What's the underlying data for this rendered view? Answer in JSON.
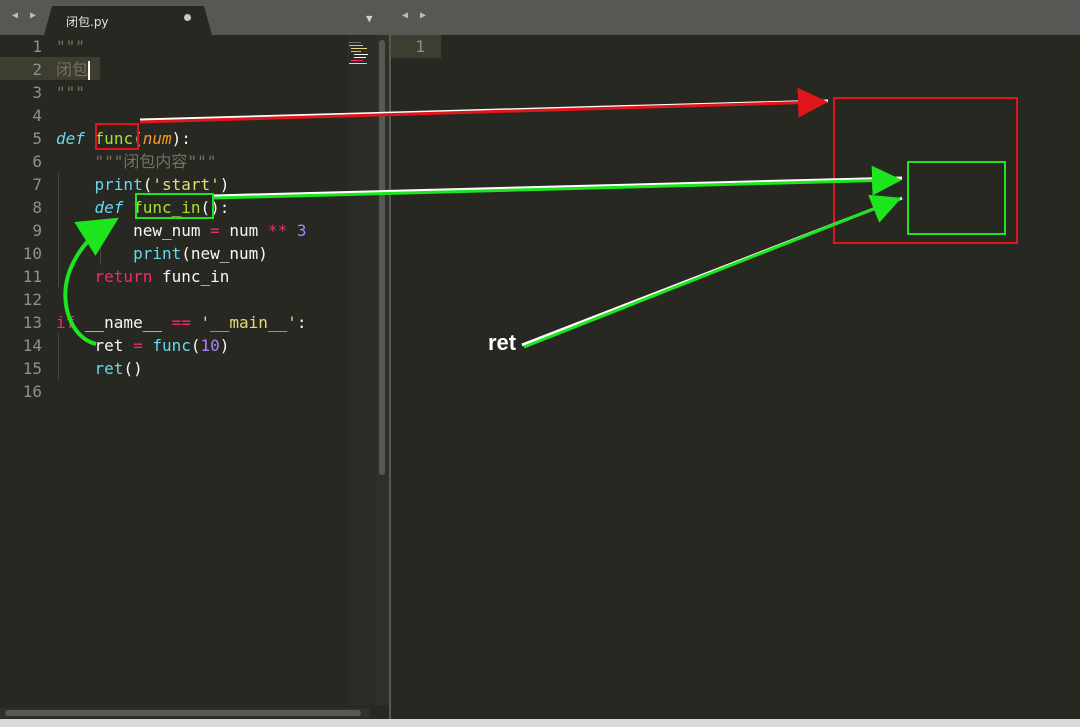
{
  "tab": {
    "title": "闭包.py"
  },
  "colors": {
    "red_annotation": "#e0161b",
    "green_annotation": "#1ee61e"
  },
  "icons": [
    "nav-arrows-icon",
    "unsaved-dot-icon",
    "dropdown-icon"
  ],
  "editor": {
    "line_numbers": [
      "1",
      "2",
      "3",
      "4",
      "5",
      "6",
      "7",
      "8",
      "9",
      "10",
      "11",
      "12",
      "13",
      "14",
      "15",
      "16"
    ],
    "lines": [
      {
        "segments": [
          {
            "t": "\"\"\"",
            "c": "cmt"
          }
        ]
      },
      {
        "segments": [
          {
            "t": "闭包",
            "c": "cmt"
          }
        ],
        "cursor": true
      },
      {
        "segments": [
          {
            "t": "\"\"\"",
            "c": "cmt"
          }
        ]
      },
      {
        "segments": []
      },
      {
        "segments": [
          {
            "t": "def",
            "c": "kw"
          },
          {
            "t": " "
          },
          {
            "t": "func",
            "c": "fn"
          },
          {
            "t": "("
          },
          {
            "t": "num",
            "c": "param"
          },
          {
            "t": "):"
          }
        ]
      },
      {
        "segments": [
          {
            "t": "    "
          },
          {
            "t": "\"\"\"闭包内容\"\"\"",
            "c": "cmt"
          }
        ]
      },
      {
        "segments": [
          {
            "t": "    "
          },
          {
            "t": "print",
            "c": "kw-plain"
          },
          {
            "t": "("
          },
          {
            "t": "'start'",
            "c": "str"
          },
          {
            "t": ")"
          }
        ]
      },
      {
        "segments": [
          {
            "t": "    "
          },
          {
            "t": "def",
            "c": "kw"
          },
          {
            "t": " "
          },
          {
            "t": "func_in",
            "c": "fn"
          },
          {
            "t": "():"
          }
        ]
      },
      {
        "segments": [
          {
            "t": "        new_num "
          },
          {
            "t": "=",
            "c": "op"
          },
          {
            "t": " num "
          },
          {
            "t": "**",
            "c": "op"
          },
          {
            "t": " "
          },
          {
            "t": "3",
            "c": "num"
          }
        ]
      },
      {
        "segments": [
          {
            "t": "        "
          },
          {
            "t": "print",
            "c": "kw-plain"
          },
          {
            "t": "(new_num)"
          }
        ]
      },
      {
        "segments": [
          {
            "t": "    "
          },
          {
            "t": "return",
            "c": "op"
          },
          {
            "t": " func_in"
          }
        ]
      },
      {
        "segments": []
      },
      {
        "segments": [
          {
            "t": "if",
            "c": "op"
          },
          {
            "t": " __name__ "
          },
          {
            "t": "==",
            "c": "op"
          },
          {
            "t": " "
          },
          {
            "t": "'__main__'",
            "c": "str"
          },
          {
            "t": ":"
          }
        ]
      },
      {
        "segments": [
          {
            "t": "    ret "
          },
          {
            "t": "=",
            "c": "op"
          },
          {
            "t": " "
          },
          {
            "t": "func",
            "c": "kw-plain"
          },
          {
            "t": "("
          },
          {
            "t": "10",
            "c": "num"
          },
          {
            "t": ")"
          }
        ]
      },
      {
        "segments": [
          {
            "t": "    "
          },
          {
            "t": "ret",
            "c": "kw-plain"
          },
          {
            "t": "()"
          }
        ]
      },
      {
        "segments": []
      }
    ]
  },
  "right_pane": {
    "line_number": "1"
  },
  "annotation": {
    "label": "ret"
  }
}
